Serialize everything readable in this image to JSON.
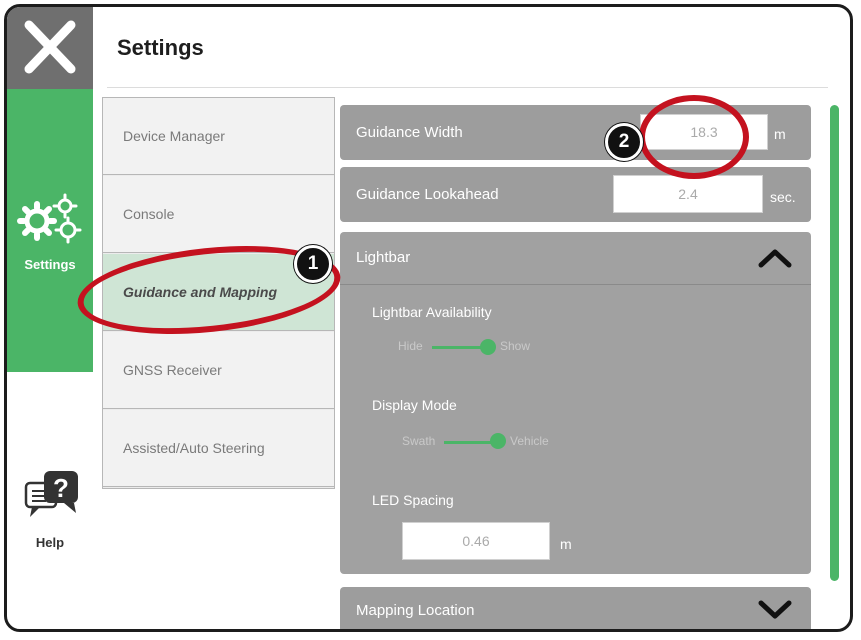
{
  "header": {
    "title": "Settings"
  },
  "rail": {
    "settings_label": "Settings",
    "help_label": "Help"
  },
  "menu": {
    "items": [
      {
        "label": "Device Manager"
      },
      {
        "label": "Console"
      },
      {
        "label": "Guidance and Mapping",
        "active": true
      },
      {
        "label": "GNSS Receiver"
      },
      {
        "label": "Assisted/Auto Steering"
      }
    ]
  },
  "guidance_width": {
    "label": "Guidance Width",
    "value": "18.3",
    "unit": "m"
  },
  "guidance_lookahead": {
    "label": "Guidance Lookahead",
    "value": "2.4",
    "unit": "sec."
  },
  "lightbar": {
    "label": "Lightbar",
    "availability": {
      "label": "Lightbar Availability",
      "off": "Hide",
      "on": "Show"
    },
    "display_mode": {
      "label": "Display Mode",
      "off": "Swath",
      "on": "Vehicle"
    },
    "led_spacing": {
      "label": "LED Spacing",
      "value": "0.46",
      "unit": "m"
    }
  },
  "mapping_location": {
    "label": "Mapping Location"
  },
  "callouts": {
    "one": "1",
    "two": "2"
  },
  "colors": {
    "accent": "#4bb567",
    "highlight": "#c4121f",
    "row_bg": "#9d9d9d"
  }
}
